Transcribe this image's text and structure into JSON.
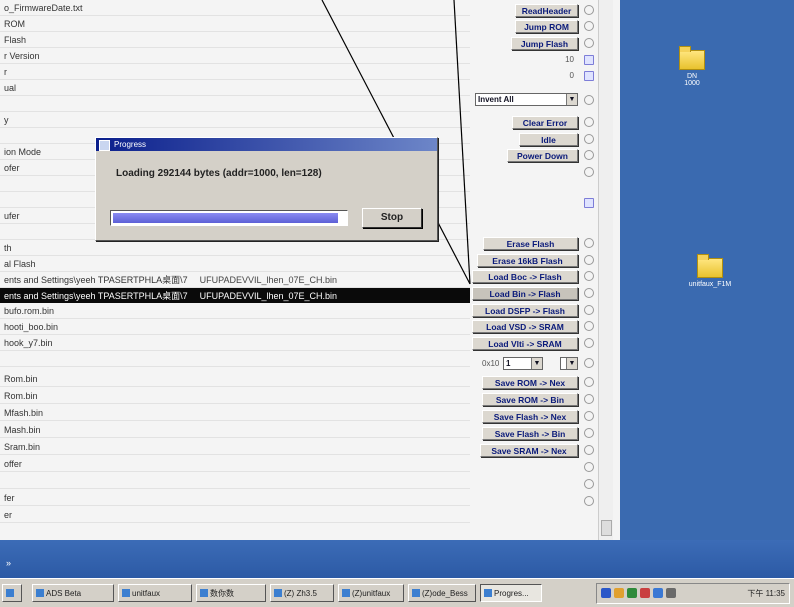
{
  "left_rows": [
    "o_FirmwareDate.txt",
    "ROM",
    "Flash",
    "r Version",
    "r",
    "ual",
    "",
    "y",
    "",
    "ion Mode",
    "ofer",
    "",
    "",
    "ufer",
    "",
    "th",
    "al Flash",
    "ents and Settings\\yeeh TPASERTPHLA桌面\\7",
    "ents and Settings\\yeeh TPASERTPHLA桌面\\7",
    "bufo.rom.bin",
    "hooti_boo.bin",
    "hook_y7.bin",
    "",
    "Rom.bin",
    "Rom.bin",
    "Mfash.bin",
    "Mash.bin",
    "Sram.bin",
    "offer",
    "",
    "fer",
    "er"
  ],
  "selected_row_index": 18,
  "row_paths": {
    "row17": "UFUPADEVVIL_lhen_07E_CH.bin",
    "row18": "UFUPADEVVIL_lhen_07E_CH.bin"
  },
  "buttons": [
    {
      "key": "b0",
      "label": "ReadHeader"
    },
    {
      "key": "b1",
      "label": "Jump ROM"
    },
    {
      "key": "b2",
      "label": "Jump Flash"
    },
    {
      "key": "b3",
      "label": "Clear Error"
    },
    {
      "key": "b4",
      "label": "Idle"
    },
    {
      "key": "b5",
      "label": "Power Down"
    },
    {
      "key": "b6",
      "label": "Erase Flash"
    },
    {
      "key": "b7",
      "label": "Erase 16kB Flash"
    },
    {
      "key": "b8",
      "label": "Load Boc -> Flash"
    },
    {
      "key": "b9",
      "label": "Load Bin -> Flash"
    },
    {
      "key": "b10",
      "label": "Load DSFP -> Flash"
    },
    {
      "key": "b11",
      "label": "Load VSD -> SRAM"
    },
    {
      "key": "b12",
      "label": "Load Vlti -> SRAM"
    },
    {
      "key": "b13",
      "label": "Save ROM -> Nex"
    },
    {
      "key": "b14",
      "label": "Save ROM -> Bin"
    },
    {
      "key": "b15",
      "label": "Save Flash -> Nex"
    },
    {
      "key": "b16",
      "label": "Save Flash -> Bin"
    },
    {
      "key": "b17",
      "label": "Save SRAM -> Nex"
    }
  ],
  "values": {
    "v1": "10",
    "v2": "0"
  },
  "selects": {
    "device": "Invent All",
    "dev2_label": "0x10",
    "dev2_value": "1"
  },
  "dialog": {
    "title": "Progress",
    "message": "Loading 292144 bytes (addr=1000, len=128)",
    "progress": 0.98,
    "stop_label": "Stop"
  },
  "desktop_icons": [
    "DN\n1000",
    "unitfaux_F1M"
  ],
  "strip_arrow": "»",
  "taskbar": {
    "items": [
      "ADS Beta",
      "unitfaux",
      "数你数",
      "(Z) Zh3.5",
      "(Z)unitfaux",
      "(Z)ode_Bess",
      "Progres..."
    ],
    "active_index": 6,
    "clock": "下午 11:35"
  },
  "colors": {
    "desktop": "#3a6ab0",
    "title_bar": "#0b1f8c",
    "selected_row": "#0a0a0a",
    "progress": "#6d70e0"
  }
}
